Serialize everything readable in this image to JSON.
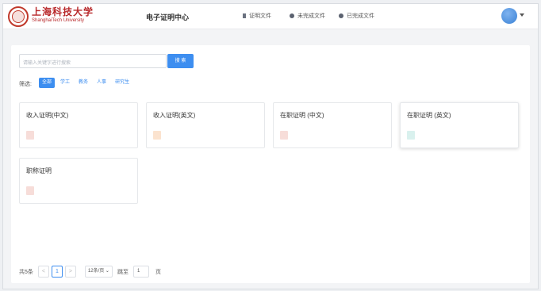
{
  "header": {
    "brand_cn": "上海科技大学",
    "brand_en": "ShanghaiTech University",
    "app_title": "电子证明中心",
    "nav": [
      {
        "label": "证明文件",
        "icon": "document-icon"
      },
      {
        "label": "未完成文件",
        "icon": "dot-icon"
      },
      {
        "label": "已完成文件",
        "icon": "check-circle-icon"
      }
    ]
  },
  "search": {
    "placeholder": "请输入关键字进行搜索",
    "button_label": "搜 索"
  },
  "filter": {
    "label": "筛选:",
    "options": [
      "全部",
      "学工",
      "教务",
      "人事",
      "研究生"
    ],
    "selected": "全部"
  },
  "cards": [
    {
      "title": "收入证明(中文)",
      "tag_color": "#f7ddd9"
    },
    {
      "title": "收入证明(英文)",
      "tag_color": "#fbe3cf"
    },
    {
      "title": "在职证明 (中文)",
      "tag_color": "#f7ddd9"
    },
    {
      "title": "在职证明 (英文)",
      "tag_color": "#d9f1ee"
    },
    {
      "title": "职称证明",
      "tag_color": "#f7ddd9"
    }
  ],
  "pagination": {
    "total_text": "共5条",
    "prev": "<",
    "current_page": "1",
    "next": ">",
    "page_size": "12条/页",
    "goto_label": "跳至",
    "goto_value": "1",
    "page_suffix": "页"
  },
  "colors": {
    "accent": "#3d8ef0",
    "brand": "#b8282a"
  }
}
